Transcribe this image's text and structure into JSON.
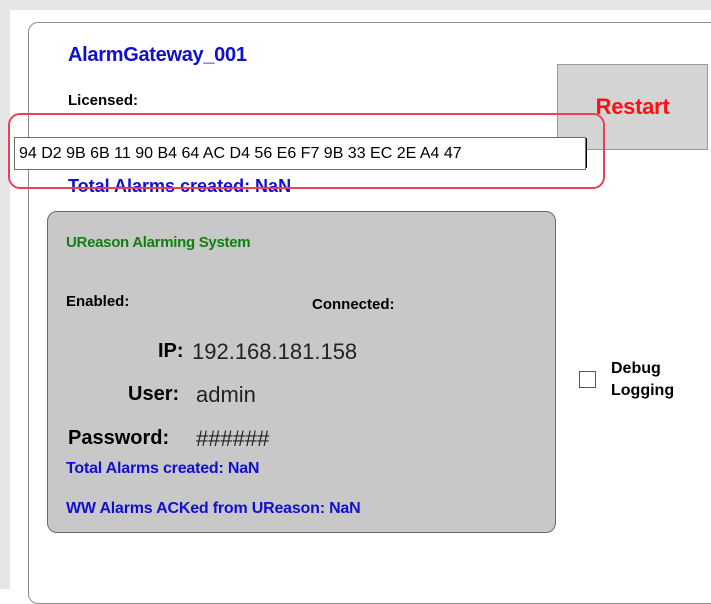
{
  "gateway": {
    "title": "AlarmGateway_001",
    "licensed_label": "Licensed:",
    "license_key": "94 D2 9B 6B 11 90 B4 64 AC D4 56 E6 F7 9B 33 EC 2E A4 47",
    "total_alarms_label": "Total Alarms created: NaN"
  },
  "restart_button": {
    "label": "Restart"
  },
  "ureason": {
    "title": "UReason Alarming System",
    "enabled_label": "Enabled:",
    "connected_label": "Connected:",
    "ip_label": "IP:",
    "ip_value": "192.168.181.158",
    "user_label": "User:",
    "user_value": "admin",
    "password_label": "Password:",
    "password_value": "######",
    "total_alarms_label": "Total Alarms created: NaN",
    "acked_label": "WW Alarms ACKed from UReason: NaN"
  },
  "debug": {
    "line1": "Debug",
    "line2": "Logging",
    "checked": false
  },
  "colors": {
    "accent_blue": "#1010d0",
    "restart_red": "#ff1010",
    "ureason_green": "#108010",
    "highlight_red": "#e8425a"
  }
}
